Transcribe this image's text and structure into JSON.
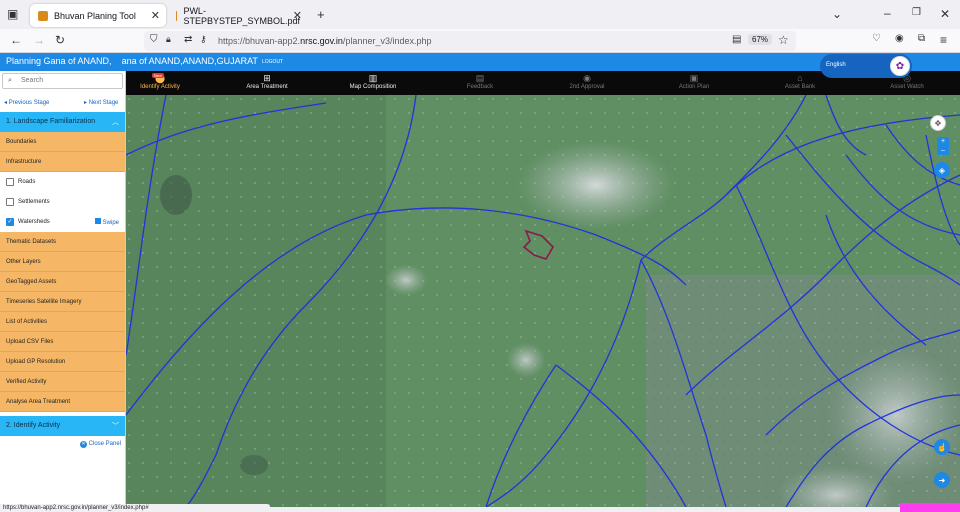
{
  "browser": {
    "tabs": [
      {
        "title": "Bhuvan Planing Tool",
        "active": true
      },
      {
        "title": "PWL-STEPBYSTEP_SYMBOL.pdf",
        "active": false
      }
    ],
    "url_prefix": "https://bhuvan-app2.",
    "url_domain": "nrsc.gov.in",
    "url_suffix": "/planner_v3/index.php",
    "zoom": "67%",
    "status_url": "https://bhuvan-app2.nrsc.gov.in/planner_v3/index.php#"
  },
  "header": {
    "title": "Planning Gana of ANAND,",
    "title_rest": "ana of ANAND,ANAND,GUJARAT",
    "logout": "LOGOUT",
    "language": "English"
  },
  "stages": [
    {
      "label": "Identify Activity",
      "icon": "pin-icon"
    },
    {
      "label": "Area Treatment",
      "icon": "plus-square-icon"
    },
    {
      "label": "Map Composition",
      "icon": "map-icon"
    },
    {
      "label": "Feedback",
      "icon": "feedback-icon"
    },
    {
      "label": "2nd Approval",
      "icon": "check-circle-icon"
    },
    {
      "label": "Action Plan",
      "icon": "save-icon"
    },
    {
      "label": "Asset Bank",
      "icon": "bank-icon"
    },
    {
      "label": "Asset Watch",
      "icon": "eye-icon"
    }
  ],
  "new_badge": "New",
  "panel": {
    "search_placeholder": "Search",
    "prev_stage": "Previous Stage",
    "next_stage": "Next Stage",
    "section1": "1. Landscape Familiarization",
    "items": [
      {
        "label": "Boundaries",
        "kind": "orange"
      },
      {
        "label": "Infrastructure",
        "kind": "orange"
      },
      {
        "label": "Roads",
        "kind": "check",
        "checked": false
      },
      {
        "label": "Settlements",
        "kind": "check",
        "checked": false
      },
      {
        "label": "Watersheds",
        "kind": "check",
        "checked": true
      },
      {
        "label": "Thematic Datasets",
        "kind": "orange"
      },
      {
        "label": "Other Layers",
        "kind": "orange"
      },
      {
        "label": "GeoTagged Assets",
        "kind": "orange"
      },
      {
        "label": "Timeseries Satellite Imagery",
        "kind": "orange"
      },
      {
        "label": "List of Activities",
        "kind": "orange"
      },
      {
        "label": "Upload CSV Files",
        "kind": "orange"
      },
      {
        "label": "Upload GP Resolution",
        "kind": "orange"
      },
      {
        "label": "Verified Activity",
        "kind": "orange"
      },
      {
        "label": "Analyse Area Treatment",
        "kind": "orange"
      }
    ],
    "swipe": "Swipe",
    "section2": "2. Identify Activity",
    "close_panel": "Close Panel"
  },
  "colors": {
    "appbar": "#1e88e5",
    "accordion": "#29b6f6",
    "menu_orange": "#f5b765",
    "active_stage": "#ffb84d",
    "watershed_line": "#2233dd",
    "aoi_outline": "#8b1a4a"
  }
}
